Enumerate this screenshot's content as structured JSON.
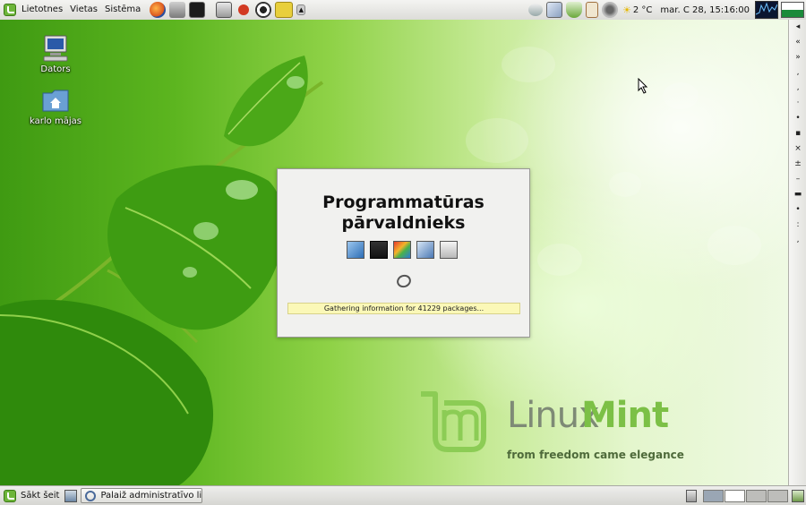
{
  "top_panel": {
    "menus": [
      {
        "label": "Lietotnes"
      },
      {
        "label": "Vietas"
      },
      {
        "label": "Sistēma"
      }
    ],
    "launchers": [
      "firefox-icon",
      "network-tools-icon",
      "terminal-icon",
      "screenshot-icon",
      "record-icon",
      "eye-of-gnome-icon",
      "folder-note-icon",
      "scroll-arrow-icon"
    ],
    "tray_icons": [
      "mail-icon",
      "network-icon",
      "update-manager-check-icon",
      "clipboard-icon",
      "volume-icon"
    ],
    "weather": "2 °C",
    "clock": "mar. C  28, 15:16:00"
  },
  "desktop": {
    "icons": [
      {
        "label": "Dators"
      },
      {
        "label": "karlo mājas"
      }
    ]
  },
  "right_panel": {
    "items": [
      "◂",
      "«",
      "»",
      ",",
      "‚",
      "·",
      "•",
      "▪",
      "×",
      "±",
      "–",
      "▬",
      "•",
      ":",
      ","
    ]
  },
  "splash": {
    "title_line1": "Programmatūras",
    "title_line2": "pārvaldnieks",
    "status": "Gathering information for 41229 packages..."
  },
  "branding": {
    "linux": "Linux",
    "mint": "Mint",
    "tagline": "from freedom came elegance"
  },
  "bottom_panel": {
    "start_label": "Sākt šeit",
    "task_label": "Palaiž administratīvo li...",
    "workspaces": 4,
    "active_workspace": 1
  },
  "colors": {
    "mint_green": "#7cc046",
    "status_bg": "#fbf8b7"
  }
}
